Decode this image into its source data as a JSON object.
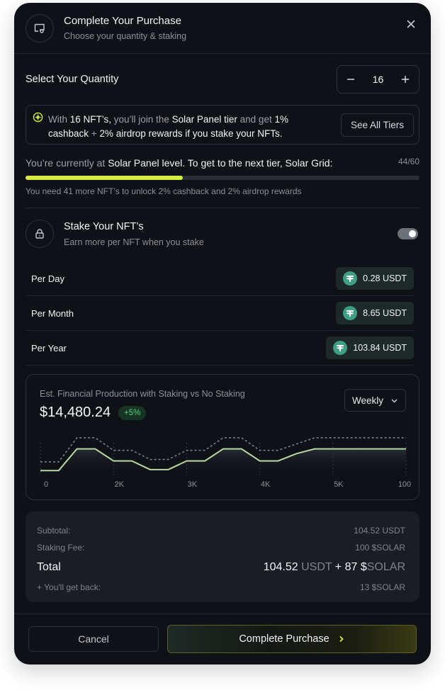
{
  "header": {
    "title": "Complete Your Purchase",
    "subtitle": "Choose your quantity & staking"
  },
  "quantity": {
    "label": "Select Your Quantity",
    "value": "16",
    "minus": "−",
    "plus": "+"
  },
  "info": {
    "t1": "With ",
    "b1": "16 NFT’s,",
    "t2": " you’ll join the ",
    "b2": "Solar Panel tier",
    "t3": " and get ",
    "b3": "1%",
    "b4": "cashback",
    "t4": " + ",
    "b5": "2% airdrop rewards if you stake your NFTs.",
    "button": "See All Tiers"
  },
  "level": {
    "t1": "You’re currently at ",
    "b1": "Solar Panel level. To get to the next tier, Solar Grid:",
    "count": "44/60",
    "progress": 0.4,
    "note": "You need 41 more NFT’s to unlock 2% cashback and 2% airdrop rewards"
  },
  "stake": {
    "title": "Stake Your NFT’s",
    "subtitle": "Earn more per NFT when you stake",
    "enabled": true,
    "rows": [
      {
        "label": "Per Day",
        "value": "0.28 USDT"
      },
      {
        "label": "Per Month",
        "value": "8.65 USDT"
      },
      {
        "label": "Per Year",
        "value": "103.84 USDT"
      }
    ]
  },
  "chart": {
    "title": "Est. Financial Production with Staking vs No Staking",
    "amount": "$14,480.24",
    "badge": "+5%",
    "period": "Weekly"
  },
  "chart_data": {
    "type": "line",
    "title": "Est. Financial Production with Staking vs No Staking",
    "tick_labels": [
      "0",
      "2K",
      "3K",
      "4K",
      "5K",
      "100"
    ],
    "x": [
      0,
      1,
      2,
      3,
      4,
      5,
      6,
      7,
      8,
      9,
      10,
      11,
      12,
      13,
      14,
      15,
      16,
      17,
      18,
      19,
      20
    ],
    "series": [
      {
        "style": "solid",
        "color": "#b7d6a4",
        "values": [
          10,
          10,
          55,
          55,
          30,
          30,
          12,
          12,
          30,
          30,
          55,
          55,
          30,
          30,
          45,
          55,
          55,
          55,
          55,
          55,
          55
        ]
      },
      {
        "style": "dashed",
        "color": "#7a7f86",
        "values": [
          28,
          28,
          78,
          78,
          52,
          52,
          33,
          33,
          52,
          52,
          78,
          78,
          52,
          52,
          65,
          78,
          78,
          78,
          78,
          78,
          78
        ]
      }
    ],
    "grid": true
  },
  "summary": {
    "subtotal_label": "Subtotal:",
    "subtotal_value": "104.52 USDT",
    "fee_label": "Staking Fee:",
    "fee_value": "100 $SOLAR",
    "total_label": "Total",
    "total_a": "104.52",
    "total_a_unit": " USDT",
    "total_plus": " + 87 ",
    "total_b_dollar": "$",
    "total_b_unit": "SOLAR",
    "back_label": "+ You'll get back:",
    "back_value": "13 $SOLAR"
  },
  "footer": {
    "cancel": "Cancel",
    "complete": "Complete Purchase"
  }
}
